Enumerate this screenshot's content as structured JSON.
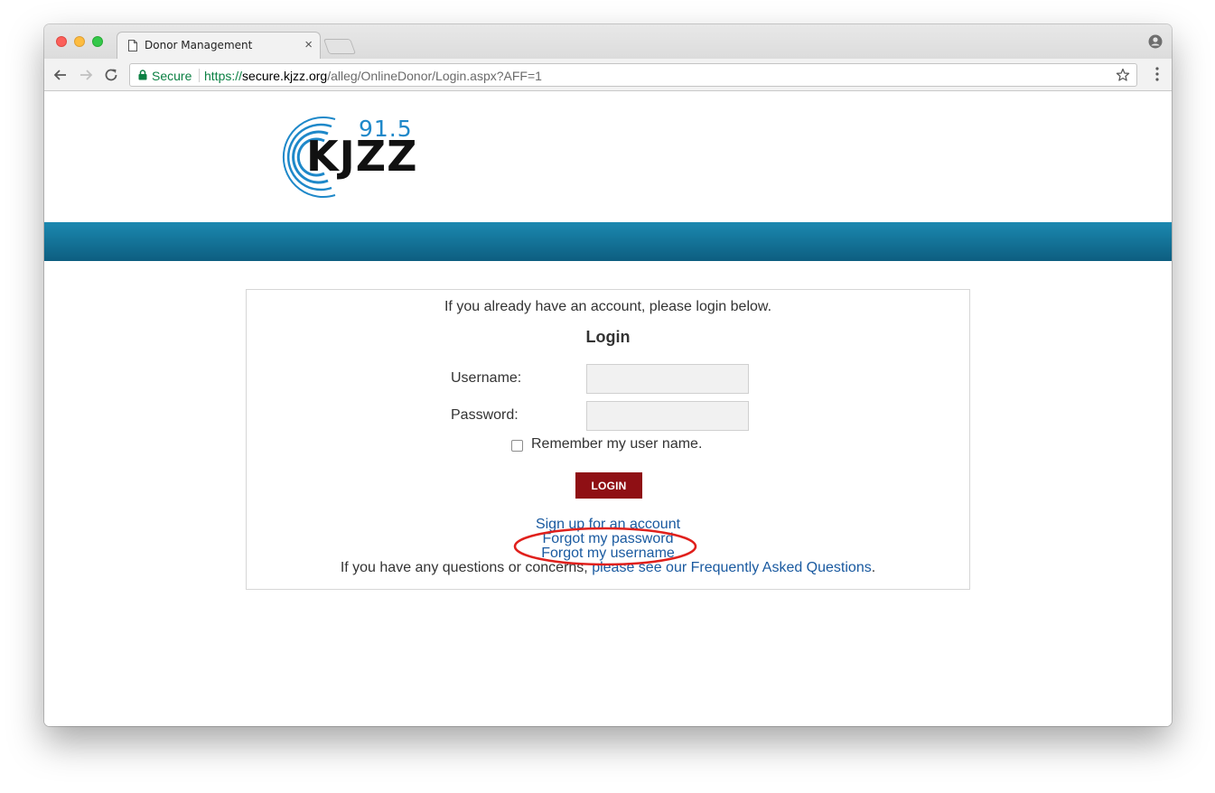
{
  "browser": {
    "tab_title": "Donor Management",
    "tab_close": "×",
    "secure_label": "Secure",
    "url_scheme": "https://",
    "url_host": "secure.kjzz.org",
    "url_path": "/alleg/OnlineDonor/Login.aspx?AFF=1",
    "colors": {
      "secure_green": "#0b8043",
      "chrome_bg": "#f2f2f2"
    }
  },
  "logo": {
    "frequency": "91.5",
    "call_sign": "KJZZ",
    "colors": {
      "arcs": "#1e88c9",
      "text": "#111111"
    }
  },
  "banner": {
    "colors": {
      "top": "#1b88b0",
      "bottom": "#0d5e80"
    }
  },
  "login": {
    "intro": "If you already have an account, please login below.",
    "heading": "Login",
    "username_label": "Username:",
    "username_value": "",
    "password_label": "Password:",
    "password_value": "",
    "remember_label": "Remember my user name.",
    "remember_checked": false,
    "login_button": "LOGIN",
    "signup_link": "Sign up for an account",
    "forgot_password_link": "Forgot my password",
    "forgot_username_link": "Forgot my username",
    "questions_text": "If you have any questions or concerns, ",
    "faq_link": "please see our Frequently Asked Questions",
    "questions_end": ".",
    "colors": {
      "button": "#8f0f14",
      "link": "#1a5aa0",
      "annotation": "#e0201c"
    }
  }
}
